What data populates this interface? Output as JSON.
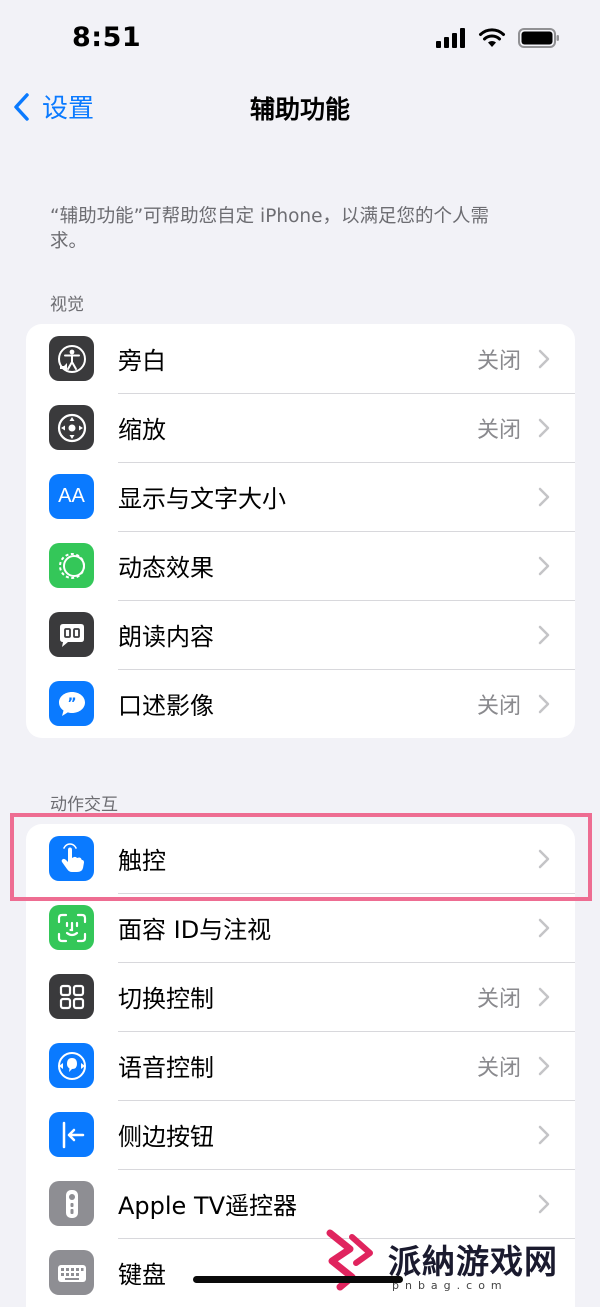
{
  "status": {
    "time": "8:51"
  },
  "nav": {
    "back_label": "设置",
    "title": "辅助功能"
  },
  "description": "“辅助功能”可帮助您自定 iPhone，以满足您的个人需求。",
  "sections": {
    "vision": {
      "header": "视觉",
      "items": [
        {
          "label": "旁白",
          "value": "关闭",
          "icon": "voiceover-icon",
          "color": "#3a3a3c"
        },
        {
          "label": "缩放",
          "value": "关闭",
          "icon": "zoom-icon",
          "color": "#3a3a3c"
        },
        {
          "label": "显示与文字大小",
          "value": "",
          "icon": "text-size-icon",
          "color": "#0a7aff"
        },
        {
          "label": "动态效果",
          "value": "",
          "icon": "motion-icon",
          "color": "#34c759"
        },
        {
          "label": "朗读内容",
          "value": "",
          "icon": "spoken-content-icon",
          "color": "#3a3a3c"
        },
        {
          "label": "口述影像",
          "value": "关闭",
          "icon": "audio-description-icon",
          "color": "#0a7aff"
        }
      ]
    },
    "interaction": {
      "header": "动作交互",
      "items": [
        {
          "label": "触控",
          "value": "",
          "icon": "touch-icon",
          "color": "#0a7aff"
        },
        {
          "label": "面容 ID与注视",
          "value": "",
          "icon": "face-id-icon",
          "color": "#34c759"
        },
        {
          "label": "切换控制",
          "value": "关闭",
          "icon": "switch-control-icon",
          "color": "#3a3a3c"
        },
        {
          "label": "语音控制",
          "value": "关闭",
          "icon": "voice-control-icon",
          "color": "#0a7aff"
        },
        {
          "label": "侧边按钮",
          "value": "",
          "icon": "side-button-icon",
          "color": "#0a7aff"
        },
        {
          "label": "Apple TV遥控器",
          "value": "",
          "icon": "apple-tv-remote-icon",
          "color": "#8e8e93"
        },
        {
          "label": "键盘",
          "value": "",
          "icon": "keyboard-icon",
          "color": "#8e8e93"
        }
      ]
    }
  },
  "watermark": {
    "text": "派納游戏网",
    "sub": "pnbag.com"
  }
}
